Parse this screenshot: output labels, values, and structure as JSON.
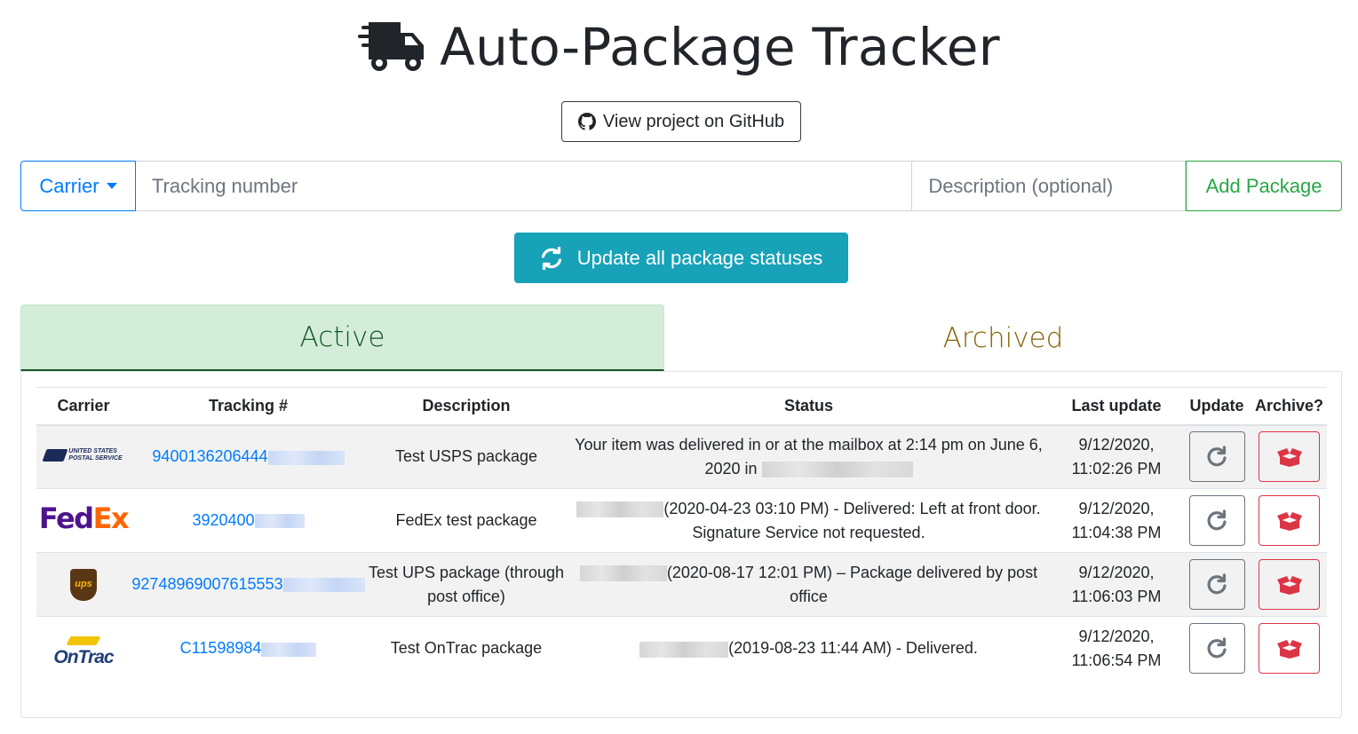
{
  "header": {
    "title": "Auto-Package Tracker",
    "github_label": "View project on GitHub"
  },
  "form": {
    "carrier_label": "Carrier",
    "tracking_placeholder": "Tracking number",
    "description_placeholder": "Description (optional)",
    "add_label": "Add Package"
  },
  "update_all_label": "Update all package statuses",
  "tabs": [
    {
      "label": "Active",
      "active": true
    },
    {
      "label": "Archived",
      "active": false
    }
  ],
  "table": {
    "headers": [
      "Carrier",
      "Tracking #",
      "Description",
      "Status",
      "Last update",
      "Update",
      "Archive?"
    ],
    "rows": [
      {
        "carrier": "USPS",
        "carrier_logo_text": "UNITED STATES POSTAL SERVICE",
        "tracking_visible": "9400136206444",
        "description": "Test USPS package",
        "status_text": "Your item was delivered in or at the mailbox at 2:14 pm on June 6, 2020 in",
        "last_update": "9/12/2020, 11:02:26 PM"
      },
      {
        "carrier": "FedEx",
        "carrier_logo_text": "FedEx",
        "tracking_visible": "3920400",
        "description": "FedEx test package",
        "status_text": "(2020-04-23 03:10 PM) - Delivered: Left at front door. Signature Service not requested.",
        "last_update": "9/12/2020, 11:04:38 PM"
      },
      {
        "carrier": "UPS",
        "carrier_logo_text": "ups",
        "tracking_visible": "92748969007615553",
        "description": "Test UPS package (through post office)",
        "status_text": "(2020-08-17 12:01 PM) – Package delivered by post office",
        "last_update": "9/12/2020, 11:06:03 PM"
      },
      {
        "carrier": "OnTrac",
        "carrier_logo_text": "OnTrac",
        "tracking_visible": "C11598984",
        "description": "Test OnTrac package",
        "status_text": "(2019-08-23 11:44 AM) - Delivered.",
        "last_update": "9/12/2020, 11:06:54 PM"
      }
    ]
  },
  "colors": {
    "primary": "#007bff",
    "success": "#28a745",
    "info": "#17a2b8",
    "danger": "#dc3545",
    "active_tab_bg": "#d4edda",
    "archived_tab_text": "#856404"
  }
}
